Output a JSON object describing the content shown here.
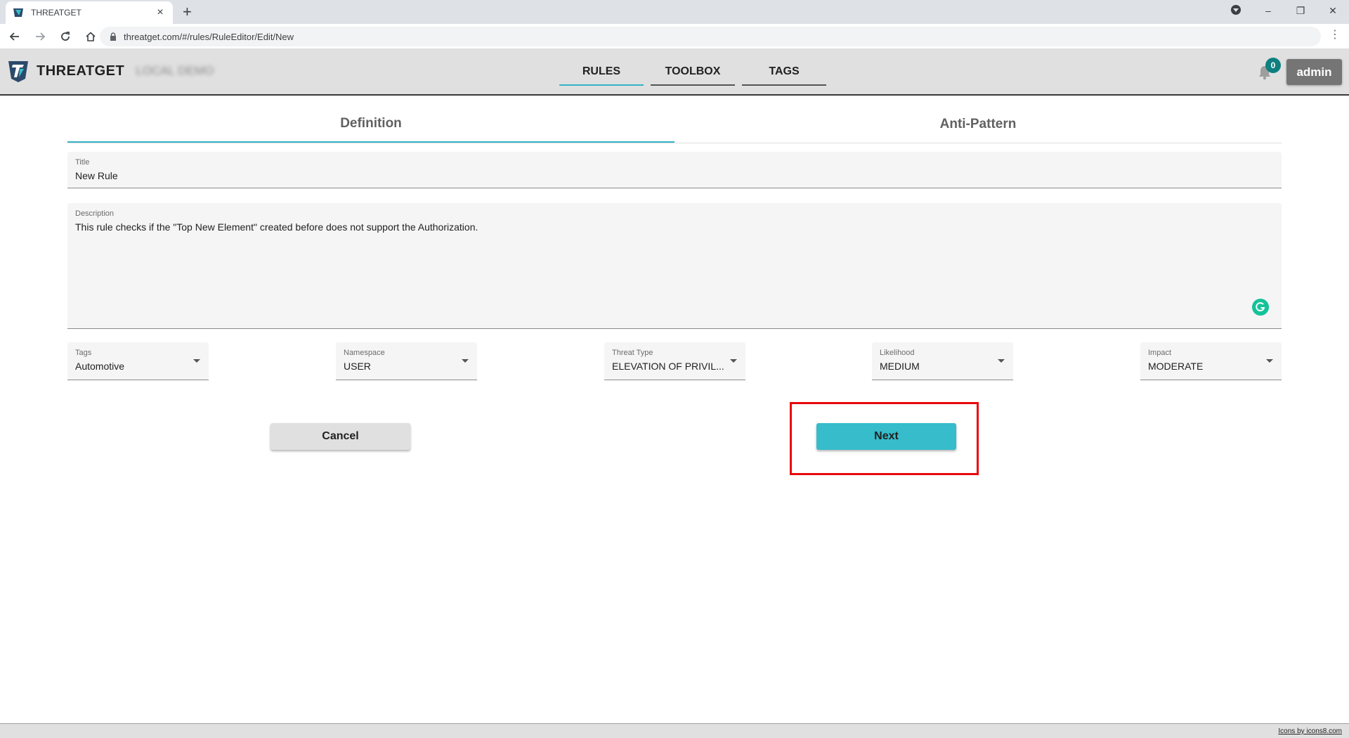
{
  "browser": {
    "tab_title": "THREATGET",
    "tab_close": "×",
    "new_tab": "+",
    "url": "threatget.com/#/rules/RuleEditor/Edit/New",
    "window_controls": {
      "minimize": "–",
      "maximize": "❐",
      "close": "✕"
    }
  },
  "header": {
    "brand_name": "THREATGET",
    "blurred_text": "LOCAL DEMO",
    "nav": [
      {
        "label": "RULES",
        "active": true
      },
      {
        "label": "TOOLBOX",
        "active": false
      },
      {
        "label": "TAGS",
        "active": false
      }
    ],
    "notification_count": "0",
    "user_label": "admin"
  },
  "editor_tabs": [
    {
      "label": "Definition",
      "active": true
    },
    {
      "label": "Anti-Pattern",
      "active": false
    }
  ],
  "form": {
    "title": {
      "label": "Title",
      "value": "New Rule"
    },
    "description": {
      "label": "Description",
      "value": "This rule checks if the \"Top New Element\" created before does not support the Authorization."
    },
    "tags": {
      "label": "Tags",
      "value": "Automotive"
    },
    "namespace": {
      "label": "Namespace",
      "value": "USER"
    },
    "threat_type": {
      "label": "Threat Type",
      "value": "ELEVATION OF PRIVIL..."
    },
    "likelihood": {
      "label": "Likelihood",
      "value": "MEDIUM"
    },
    "impact": {
      "label": "Impact",
      "value": "MODERATE"
    }
  },
  "buttons": {
    "cancel": "Cancel",
    "next": "Next"
  },
  "footer": {
    "credit": "Icons by icons8.com"
  },
  "colors": {
    "accent": "#36bccb",
    "highlight": "#e8080d",
    "header_bg": "#e0e0e0"
  }
}
